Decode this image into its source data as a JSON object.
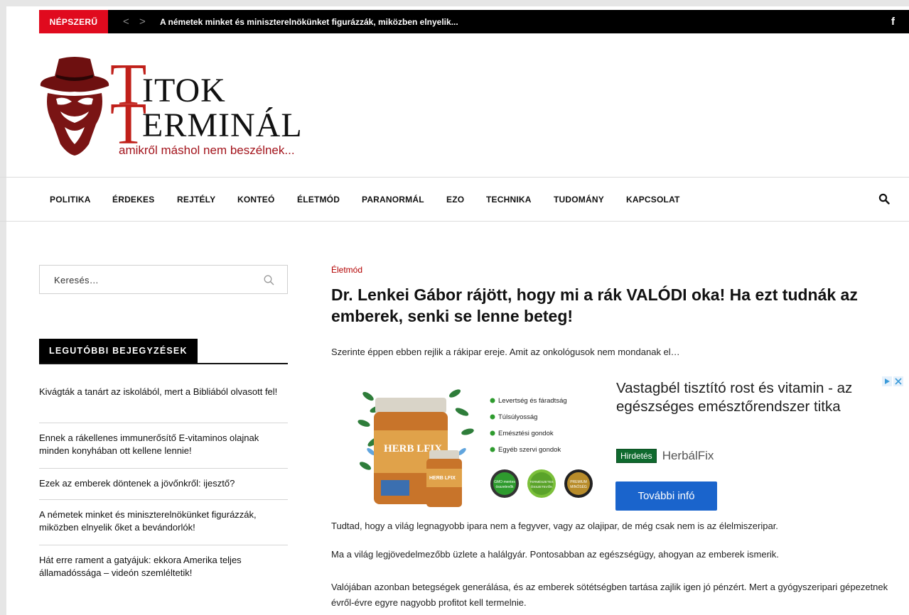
{
  "topbar": {
    "badge": "NÉPSZERŰ",
    "prev_arrow": "<",
    "next_arrow": ">",
    "ticker_text": "A németek minket és miniszterelnökünket figurázzák, miközben elnyelik...",
    "social_icon": "f"
  },
  "logo": {
    "letter1": "T",
    "word1": "ITOK",
    "letter2": "T",
    "word2": "ERMINÁL",
    "tagline": "amikről máshol nem beszélnek..."
  },
  "nav": {
    "items": [
      "POLITIKA",
      "ÉRDEKES",
      "REJTÉLY",
      "KONTEÓ",
      "ÉLETMÓD",
      "PARANORMÁL",
      "EZO",
      "TECHNIKA",
      "TUDOMÁNY",
      "KAPCSOLAT"
    ],
    "search_icon": "search-icon"
  },
  "sidebar": {
    "search_placeholder": "Keresés…",
    "widget_title": "LEGUTÓBBI BEJEGYZÉSEK",
    "posts": [
      "Kivágták a tanárt az iskolából, mert a Bibliából olvasott fel!",
      "Ennek a rákellenes immunerősítő E-vitaminos olajnak minden konyhában ott kellene lennie!",
      "Ezek az emberek döntenek a jövőnkről: ijesztő?",
      "A németek minket és miniszterelnökünket figurázzák, miközben elnyelik őket a bevándorlók!",
      "Hát erre rament a gatyájuk: ekkora Amerika teljes államadóssága – videón szemléltetik!"
    ]
  },
  "article": {
    "category": "Életmód",
    "title": "Dr. Lenkei Gábor rájött, hogy mi a rák VALÓDI oka! Ha ezt tudnák az emberek, senki se lenne beteg!",
    "intro": "Szerinte éppen ebben rejlik a rákipar ereje. Amit az onkológusok nem mondanak el…",
    "paragraphs": [
      "Tudtad, hogy a világ legnagyobb ipara nem a fegyver, vagy az olajipar, de még csak nem is az élelmiszeripar.",
      "Ma a világ legjövedelmezőbb üzlete a halálgyár. Pontosabban az egészségügy, ahogyan az emberek ismerik.",
      "Valójában azonban betegségek generálása, és az emberek sötétségben tartása zajlik igen jó pénzért. Mert a gyógyszeripari gépezetnek évről-évre egyre nagyobb profitot kell termelnie."
    ]
  },
  "ad": {
    "bullets": [
      "Levertség és fáradtság",
      "Túlsúlyosság",
      "Emésztési gondok",
      "Egyéb szervi gondok"
    ],
    "product_name": "HERB LFIX",
    "seals": [
      "GMO mentes összetevők",
      "TERMÉSZETES ÖSSZETEVŐK",
      "PREMIUM MINŐSÉG"
    ],
    "headline": "Vastagbél tisztító rost és vitamin - az egészséges emésztőrendszer titka",
    "label": "Hirdetés",
    "brand": "HerbálFix",
    "cta": "További infó",
    "colors": {
      "cta": "#1a64cc",
      "label_bg": "#0f6a2e",
      "bullet": "#2e9b2e"
    }
  },
  "colors": {
    "accent_red": "#e00a1e",
    "logo_red": "#c0201a",
    "tagline": "#a3141c",
    "category": "#b30000"
  }
}
